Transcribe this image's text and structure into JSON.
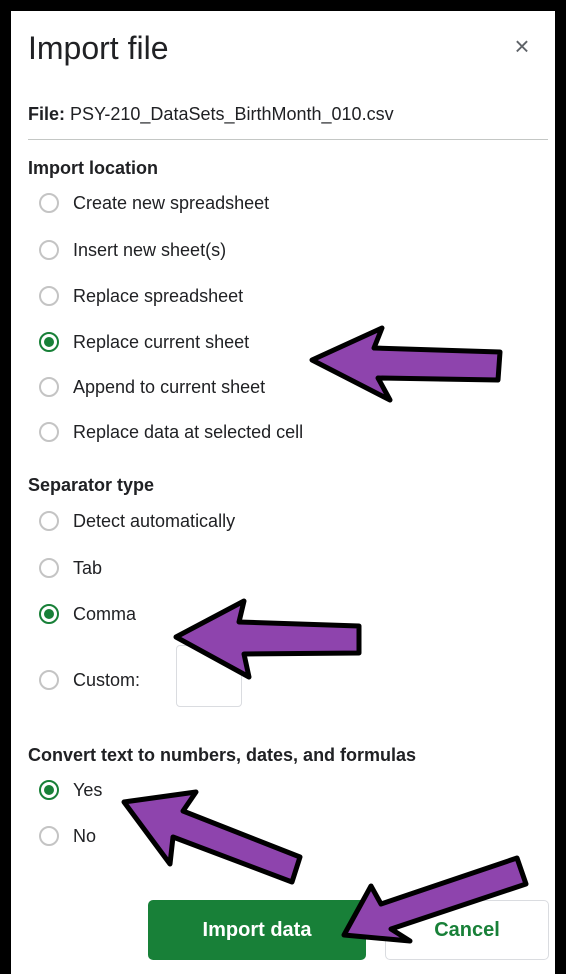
{
  "dialog": {
    "title": "Import file",
    "close_icon": "×",
    "file_label": "File:",
    "file_name": "PSY-210_DataSets_BirthMonth_010.csv"
  },
  "import_location": {
    "title": "Import location",
    "options": [
      {
        "label": "Create new spreadsheet",
        "checked": false
      },
      {
        "label": "Insert new sheet(s)",
        "checked": false
      },
      {
        "label": "Replace spreadsheet",
        "checked": false
      },
      {
        "label": "Replace current sheet",
        "checked": true
      },
      {
        "label": "Append to current sheet",
        "checked": false
      },
      {
        "label": "Replace data at selected cell",
        "checked": false
      }
    ]
  },
  "separator_type": {
    "title": "Separator type",
    "options": [
      {
        "label": "Detect automatically",
        "checked": false
      },
      {
        "label": "Tab",
        "checked": false
      },
      {
        "label": "Comma",
        "checked": true
      },
      {
        "label": "Custom:",
        "checked": false
      }
    ],
    "custom_value": ""
  },
  "convert_text": {
    "title": "Convert text to numbers, dates, and formulas",
    "options": [
      {
        "label": "Yes",
        "checked": true
      },
      {
        "label": "No",
        "checked": false
      }
    ]
  },
  "buttons": {
    "import_label": "Import data",
    "cancel_label": "Cancel"
  },
  "colors": {
    "primary_green": "#188038",
    "annotation_arrow": "#8e44ad"
  }
}
